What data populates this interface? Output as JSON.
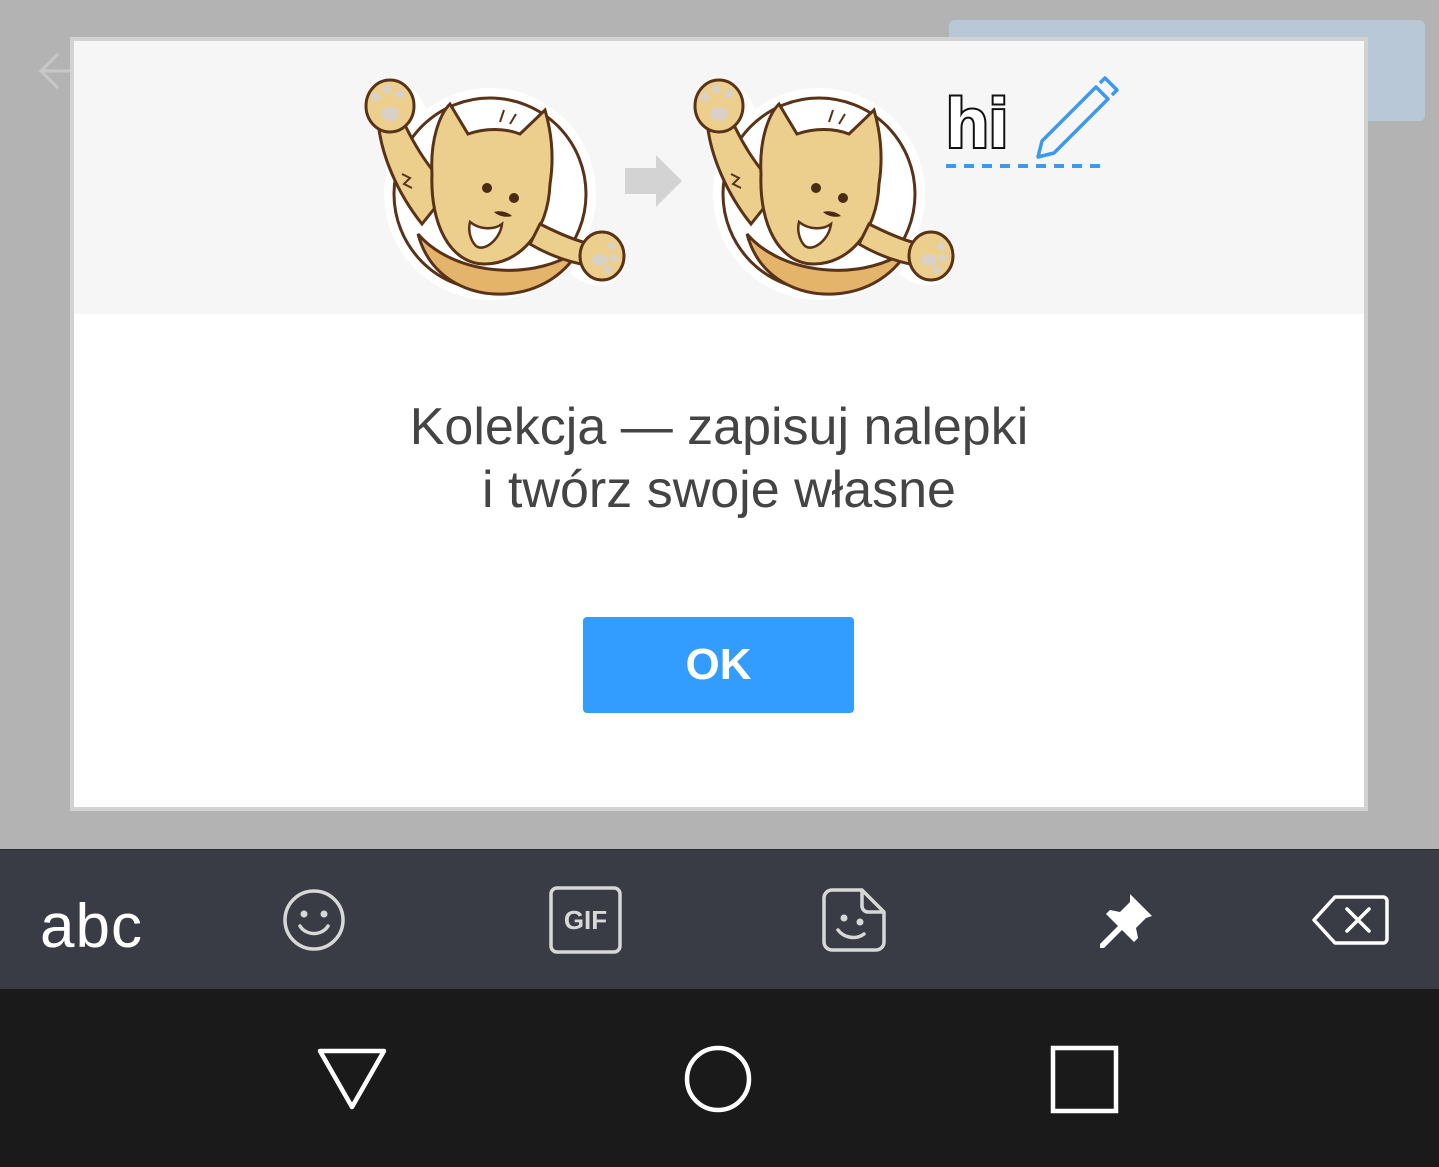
{
  "dialog": {
    "illustration": {
      "badge_text": "hi"
    },
    "title_line1": "Kolekcja — zapisuj nalepki",
    "title_line2": "i twórz swoje własne",
    "ok_label": "OK"
  },
  "keyboard": {
    "abc_label": "abc",
    "gif_label": "GIF",
    "icons": [
      "emoji-icon",
      "gif-icon",
      "sticker-icon",
      "pin-icon",
      "backspace-icon"
    ]
  },
  "navbar": {
    "icons": [
      "back-triangle-icon",
      "home-circle-icon",
      "recents-square-icon"
    ]
  },
  "colors": {
    "accent": "#339cff",
    "keyboard_bg": "#3a3c45",
    "navbar_bg": "#1a1a1a",
    "scrim": "#b3b3b3",
    "cat_fill": "#eccf8c",
    "cat_outline": "#5a3218"
  }
}
